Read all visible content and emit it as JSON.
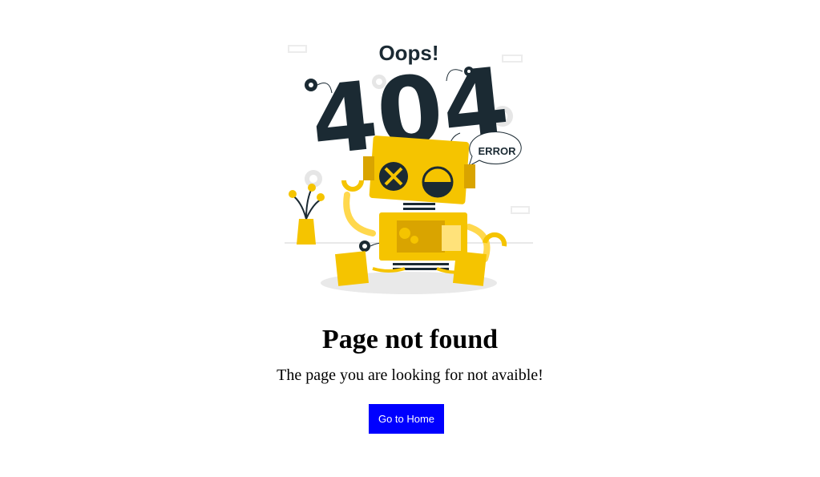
{
  "illustration": {
    "oops_text": "Oops!",
    "code_text": "404",
    "error_text": "ERROR"
  },
  "title": "Page not found",
  "subtitle": "The page you are looking for not avaible!",
  "home_button": {
    "label": "Go to Home",
    "background": "#0000ff"
  },
  "colors": {
    "robot_yellow": "#f5c400",
    "robot_dark_yellow": "#d9a400",
    "ink": "#1b2a33"
  }
}
